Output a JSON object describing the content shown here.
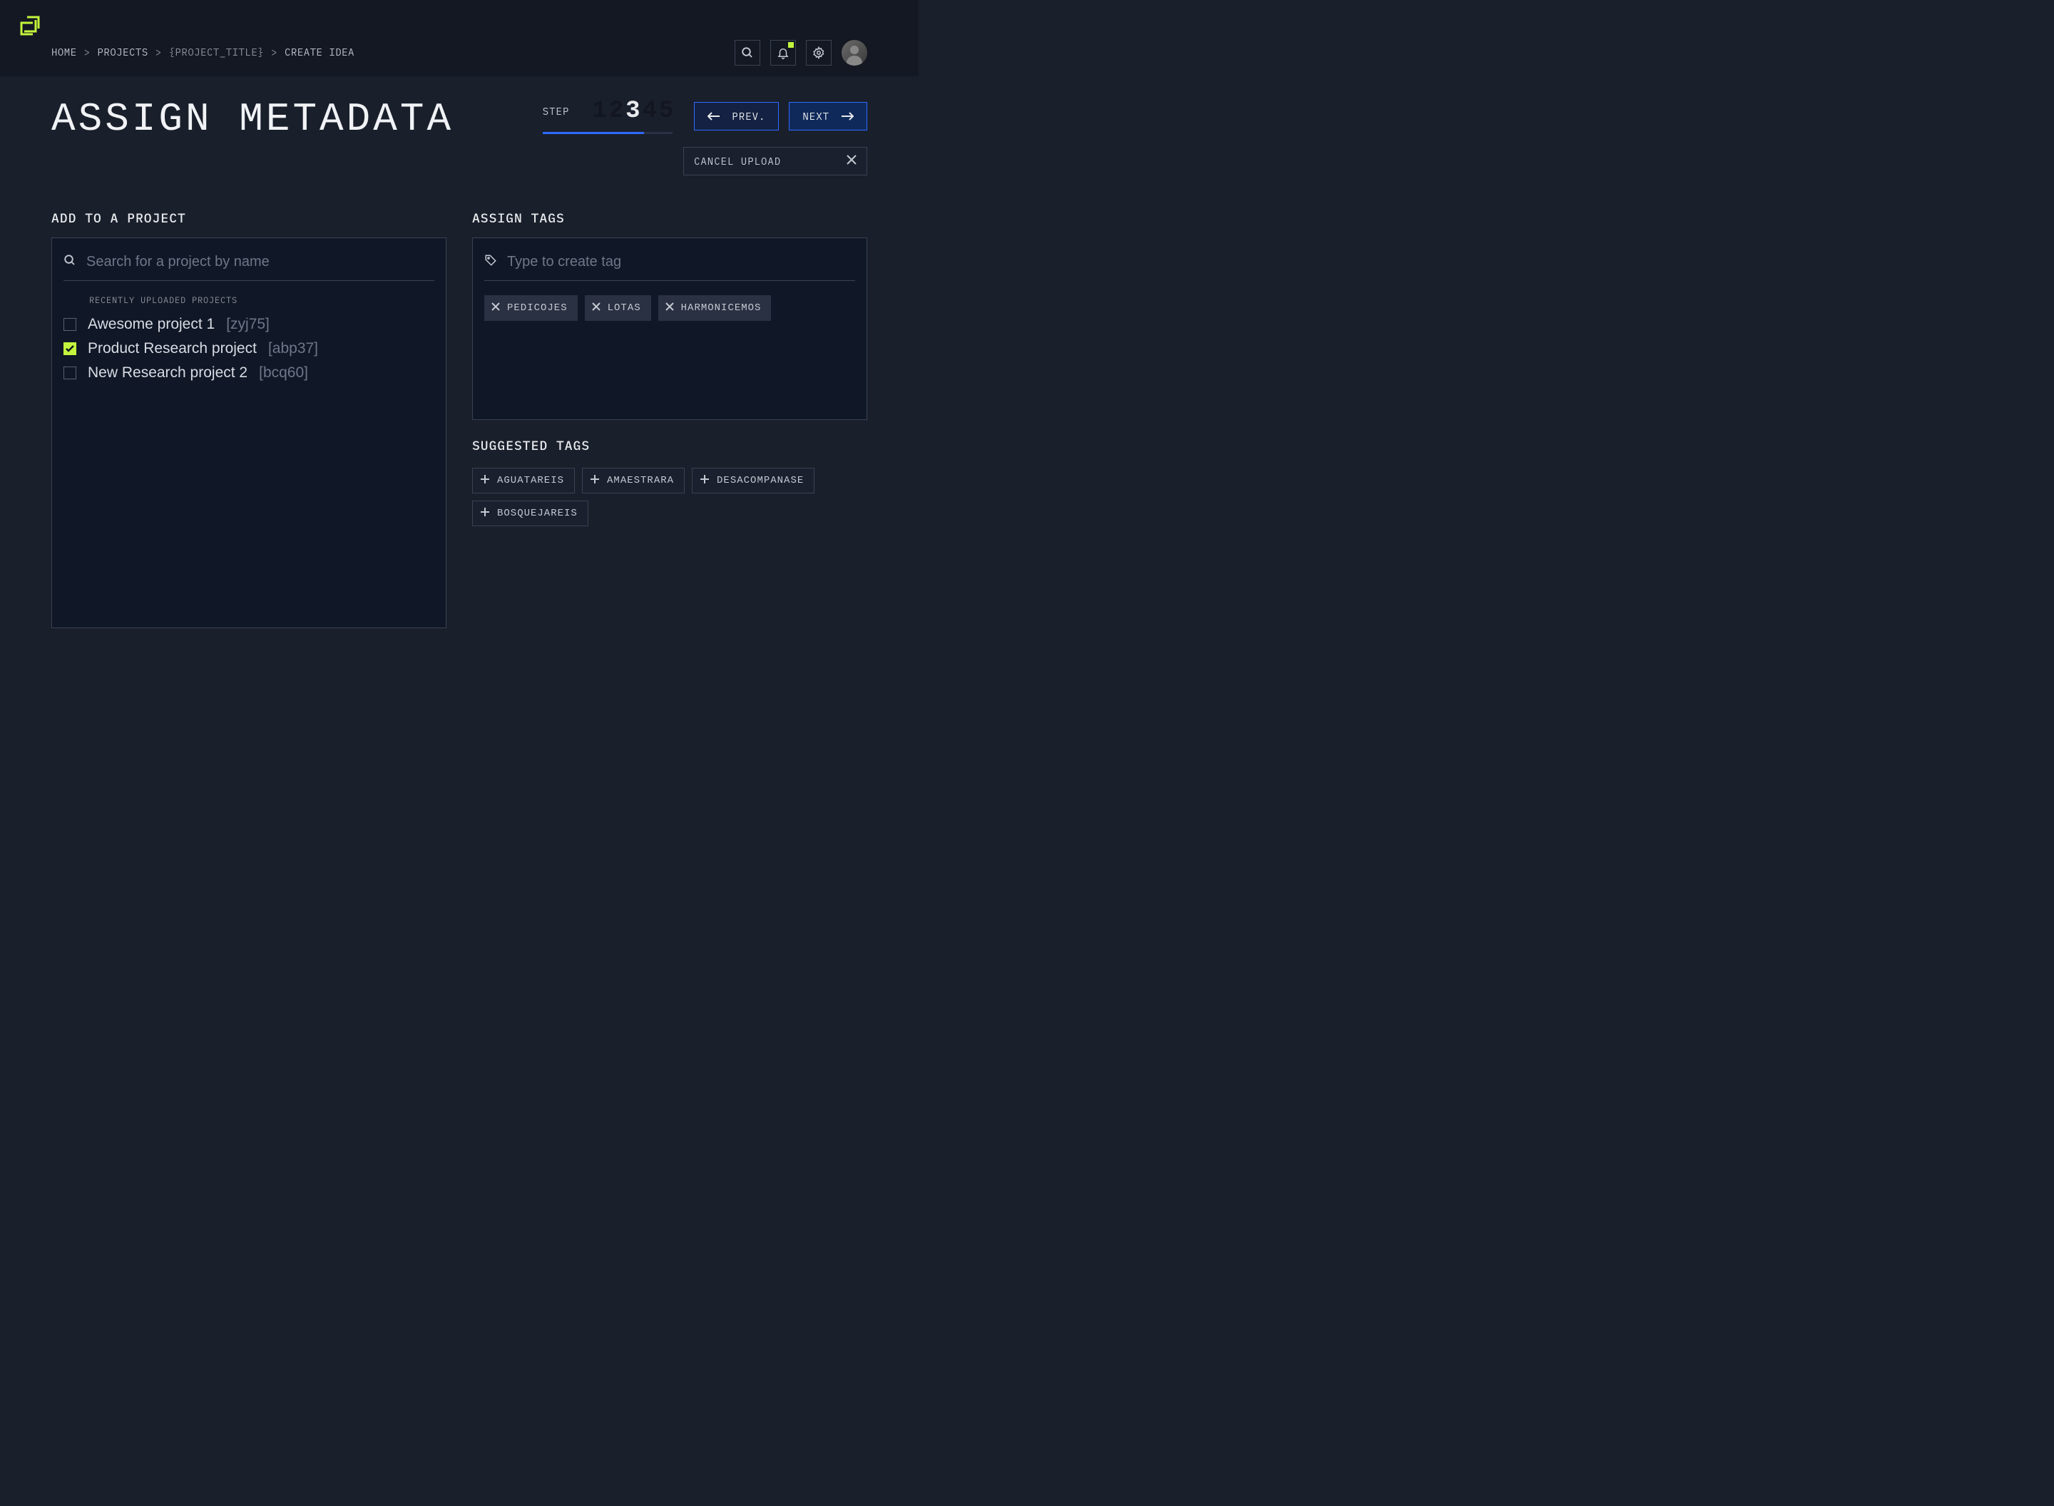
{
  "breadcrumb": {
    "home": "HOME",
    "projects": "PROJECTS",
    "project_title": "{PROJECT_TITLE}",
    "create_idea": "CREATE IDEA"
  },
  "page_title": "ASSIGN METADATA",
  "step": {
    "label": "STEP",
    "numbers": [
      "1",
      "2",
      "3",
      "4",
      "5"
    ],
    "active": 3
  },
  "nav": {
    "prev": "PREV.",
    "next": "NEXT",
    "cancel": "CANCEL UPLOAD"
  },
  "projects": {
    "title": "ADD TO A PROJECT",
    "search_placeholder": "Search for a project by name",
    "section_label": "RECENTLY UPLOADED PROJECTS",
    "items": [
      {
        "name": "Awesome project 1",
        "code": "[zyj75]",
        "checked": false
      },
      {
        "name": "Product Research project",
        "code": "[abp37]",
        "checked": true
      },
      {
        "name": "New Research project 2",
        "code": "[bcq60]",
        "checked": false
      }
    ]
  },
  "tags": {
    "title": "ASSIGN TAGS",
    "input_placeholder": "Type to create tag",
    "assigned": [
      "PEDICOJES",
      "LOTAS",
      "HARMONICEMOS"
    ],
    "suggested_title": "SUGGESTED TAGS",
    "suggested": [
      "AGUATAREIS",
      "AMAESTRARA",
      "DESACOMPANASE",
      "BOSQUEJAREIS"
    ]
  }
}
